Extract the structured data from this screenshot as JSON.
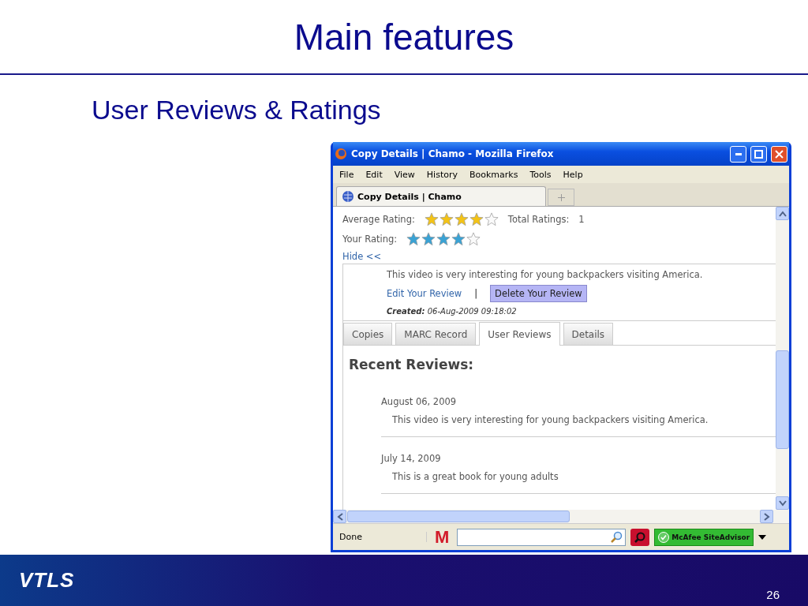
{
  "slide": {
    "title": "Main features",
    "subtitle": "User Reviews & Ratings",
    "logo": "VTLS",
    "page_number": "26"
  },
  "browser": {
    "title": "Copy Details | Chamo - Mozilla Firefox",
    "menu": [
      "File",
      "Edit",
      "View",
      "History",
      "Bookmarks",
      "Tools",
      "Help"
    ],
    "tab": "Copy Details | Chamo",
    "status": "Done",
    "toolbar_logo": "M",
    "siteadvisor": "McAfee SiteAdvisor"
  },
  "ratings": [
    {
      "kind": "average",
      "label": "Average Rating:",
      "stars": 4
    },
    {
      "kind": "user",
      "label": "Your Rating:",
      "stars": 4
    }
  ],
  "total_ratings": {
    "label": "Total Ratings:",
    "value": "1"
  },
  "hide_link": "Hide <<",
  "my_review": {
    "text": "This video is very interesting for young backpackers visiting America.",
    "edit": "Edit Your Review",
    "separator": "|",
    "delete": "Delete Your Review",
    "created": "**Created:** 06-Aug-2009 09:18:02"
  },
  "tabs": [
    {
      "label": "Copies",
      "selected": false
    },
    {
      "label": "MARC Record",
      "selected": false
    },
    {
      "label": "User Reviews",
      "selected": true
    },
    {
      "label": "Details",
      "selected": false
    }
  ],
  "recent": {
    "heading": "Recent Reviews:",
    "reviews": [
      {
        "date": "August 06, 2009",
        "text": "This video is very interesting for young backpackers visiting America."
      },
      {
        "date": "July 14, 2009",
        "text": "This is a great book for young adults"
      }
    ]
  }
}
